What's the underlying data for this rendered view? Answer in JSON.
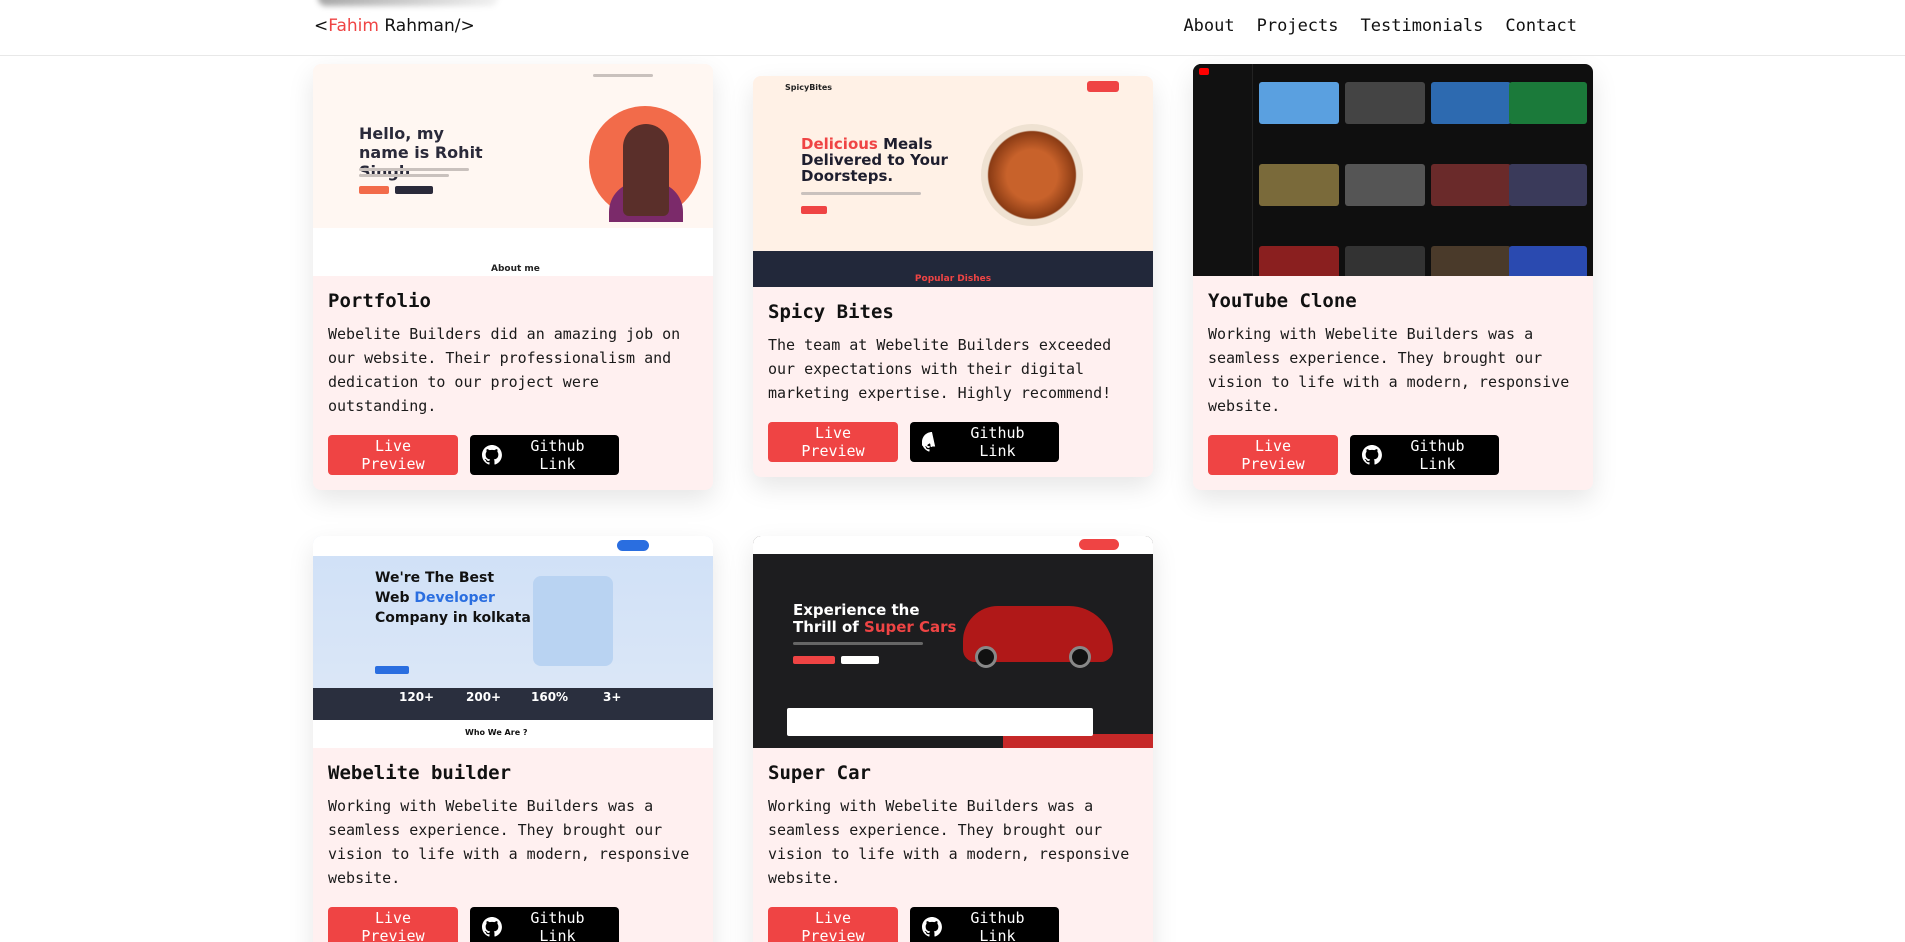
{
  "header": {
    "logo_open": "<",
    "logo_name": "Fahim",
    "logo_rest": " Rahman/>",
    "nav": [
      "About",
      "Projects",
      "Testimonials",
      "Contact"
    ]
  },
  "projects": [
    {
      "title": "Portfolio",
      "description": "Webelite Builders did an amazing job on our website. Their professionalism and dedication to our project were outstanding.",
      "live_label": "Live Preview",
      "github_label": "Github Link",
      "thumbnail": {
        "headline": "Hello, my name is Rohit Singh",
        "section": "About me"
      }
    },
    {
      "title": "Spicy Bites",
      "description": "The team at Webelite Builders exceeded our expectations with their digital marketing expertise. Highly recommend!",
      "live_label": "Live Preview",
      "github_label": "Github Link",
      "thumbnail": {
        "brand": "SpicyBites",
        "headline_red": "Delicious",
        "headline_rest": " Meals Delivered to Your Doorsteps.",
        "section": "Popular Dishes"
      }
    },
    {
      "title": "YouTube Clone",
      "description": "Working with Webelite Builders was a seamless experience. They brought our vision to life with a modern, responsive website.",
      "live_label": "Live Preview",
      "github_label": "Github Link",
      "thumbnail": {}
    },
    {
      "title": "Webelite builder",
      "description": "Working with Webelite Builders was a seamless experience. They brought our vision to life with a modern, responsive website.",
      "live_label": "Live Preview",
      "github_label": "Github Link",
      "thumbnail": {
        "headline_a": "We're The Best",
        "headline_b": "Web ",
        "headline_blue": "Developer",
        "headline_c": "Company in kolkata",
        "stats": [
          "120+",
          "200+",
          "160%",
          "3+"
        ],
        "section": "Who We Are ?"
      }
    },
    {
      "title": "Super Car",
      "description": "Working with Webelite Builders was a seamless experience. They brought our vision to life with a modern, responsive website.",
      "live_label": "Live Preview",
      "github_label": "Github Link",
      "thumbnail": {
        "headline_a": "Experience the",
        "headline_b": "Thrill of ",
        "headline_red": "Super Cars"
      }
    }
  ],
  "colors": {
    "accent": "#ef4444",
    "card_bg": "#fff0f0",
    "github_button": "#000000"
  }
}
